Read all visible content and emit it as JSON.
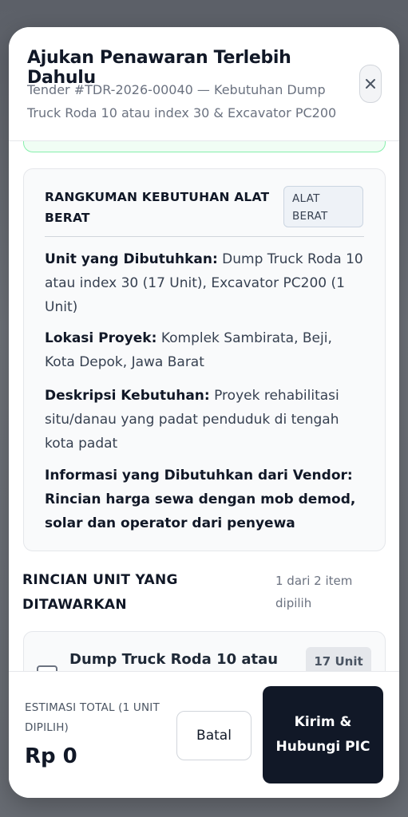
{
  "modal": {
    "title": "Ajukan Penawaran Terlebih Dahulu",
    "subtitle": "Tender #TDR-2026-00040 — Kebutuhan Dump Truck Roda 10 atau index 30 & Excavator PC200",
    "close_icon": "close-icon"
  },
  "summary": {
    "title": "RANGKUMAN KEBUTUHAN ALAT BERAT",
    "badge": "ALAT BERAT",
    "fields": [
      {
        "label": "Unit yang Dibutuhkan:",
        "value": "Dump Truck Roda 10 atau index 30 (17 Unit), Excavator PC200 (1 Unit)"
      },
      {
        "label": "Lokasi Proyek:",
        "value": "Komplek Sambirata, Beji, Kota Depok, Jawa Barat"
      },
      {
        "label": "Deskripsi Kebutuhan:",
        "value": "Proyek rehabilitasi situ/danau yang padat penduduk di tengah kota padat"
      },
      {
        "label": "Informasi yang Dibutuhkan dari Vendor:",
        "value": "Rincian harga sewa dengan mob demod, solar dan operator dari penyewa"
      }
    ]
  },
  "units_section": {
    "title": "RINCIAN UNIT YANG DITAWARKAN",
    "count": "1 dari 2 item dipilih",
    "items": [
      {
        "name": "Dump Truck Roda 10 atau",
        "qty": "17 Unit",
        "checked": false
      }
    ]
  },
  "footer": {
    "estimate_label": "ESTIMASI TOTAL (1 UNIT DIPILIH)",
    "estimate_value": "Rp 0",
    "cancel_label": "Batal",
    "submit_label": "Kirim & Hubungi PIC"
  }
}
